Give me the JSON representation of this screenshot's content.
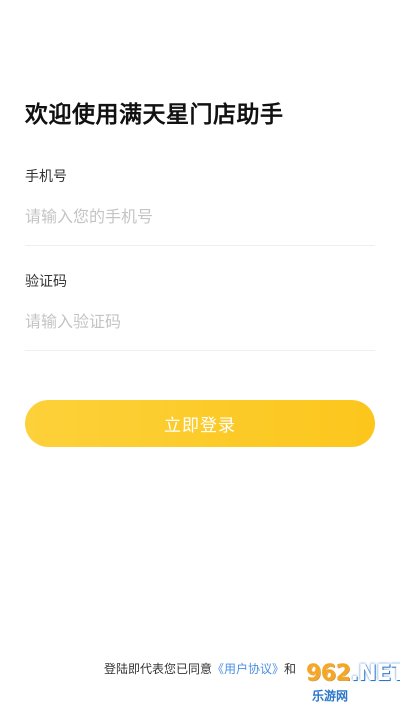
{
  "header": {
    "title": "欢迎使用满天星门店助手"
  },
  "form": {
    "phone": {
      "label": "手机号",
      "placeholder": "请输入您的手机号",
      "value": ""
    },
    "code": {
      "label": "验证码",
      "placeholder": "请输入验证码",
      "value": ""
    },
    "submit_label": "立即登录"
  },
  "footer": {
    "agreement_prefix": "登陆即代表您已同意",
    "user_agreement_link": "《用户协议》",
    "conjunction": "和"
  },
  "watermark": {
    "brand_numbers": "962",
    "brand_suffix": ".NET",
    "subtitle": "乐游网"
  },
  "colors": {
    "accent": "#fcc61c",
    "link": "#4a90e2",
    "text_primary": "#111111",
    "placeholder": "#c4c4c4"
  }
}
